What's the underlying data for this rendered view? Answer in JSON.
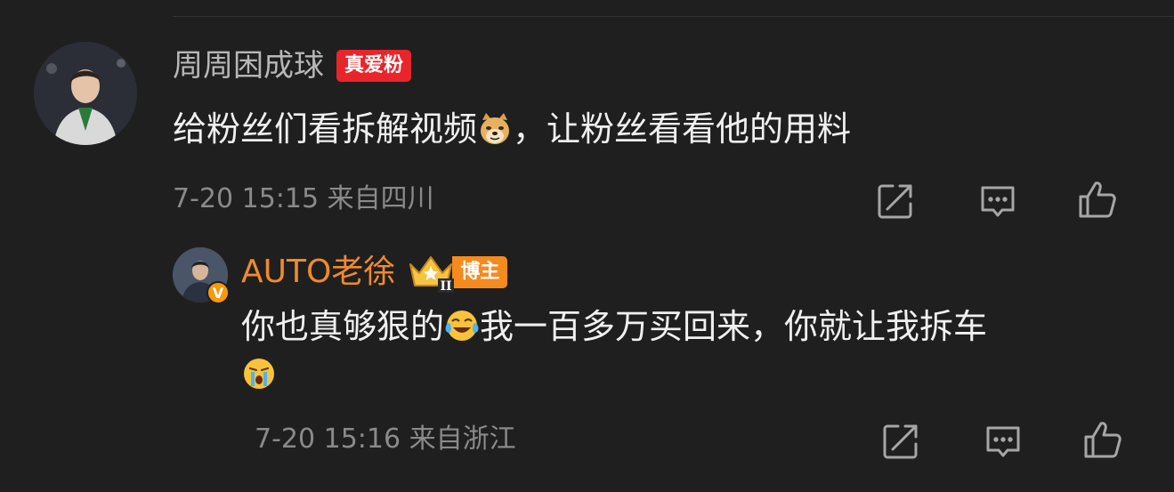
{
  "main_comment": {
    "username": "周周困成球",
    "fan_badge": "真爱粉",
    "text_before_emoji": "给粉丝们看拆解视频",
    "emoji": "doge-emoji",
    "text_after_emoji": "，让粉丝看看他的用料",
    "meta": "7-20 15:15 来自四川"
  },
  "reply": {
    "username": "AUTO老徐",
    "verified_mark": "V",
    "crown_level": "II",
    "role_badge": "博主",
    "text_before_emoji": "你也真够狠的",
    "emoji_1": "laugh-cry-emoji",
    "text_middle": "我一百多万买回来，你就让我拆车",
    "emoji_2": "crying-emoji",
    "meta": "7-20 15:16 来自浙江"
  },
  "actions": {
    "icons": [
      "share-icon",
      "comment-icon",
      "like-icon"
    ]
  },
  "colors": {
    "background": "#1f1f1f",
    "fan_badge": "#e8252a",
    "reply_username": "#f08a2c",
    "blogger_badge": "#f58a1f",
    "meta_text": "#8a8a8a"
  }
}
